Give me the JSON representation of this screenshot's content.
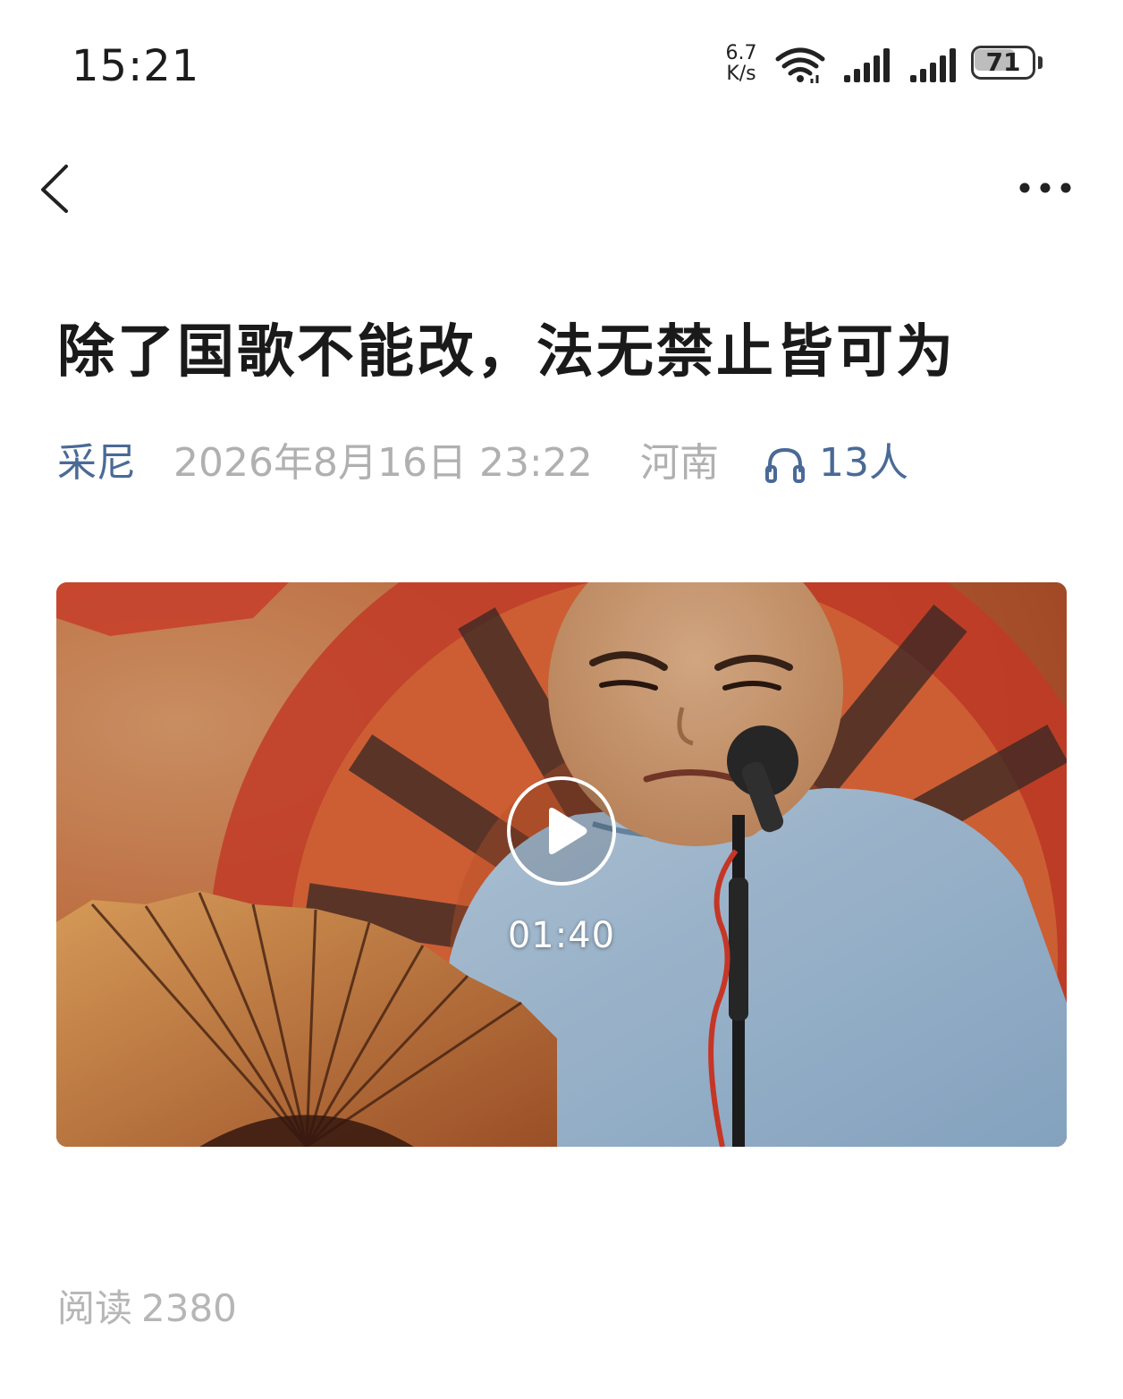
{
  "status_bar": {
    "time": "15:21",
    "net_speed_value": "6.7",
    "net_speed_unit": "K/s",
    "battery_level": "71",
    "battery_fraction": 0.71,
    "icons": [
      "wifi-icon",
      "signal-icon",
      "signal-icon",
      "battery-icon"
    ]
  },
  "nav": {
    "back_icon": "chevron-left-icon",
    "more_icon": "more-dots-icon"
  },
  "article": {
    "title": "除了国歌不能改，法无禁止皆可为",
    "author": "采尼",
    "datetime": "2026年8月16日 23:22",
    "region": "河南",
    "listen_icon": "headphones-icon",
    "listeners": "13人"
  },
  "video": {
    "play_icon": "play-icon",
    "duration": "01:40"
  },
  "stats": {
    "reads_label": "阅读",
    "reads_count": "2380"
  },
  "colors": {
    "link": "#4a6a96",
    "muted": "#b0b0b0",
    "title": "#1a1a1a"
  }
}
